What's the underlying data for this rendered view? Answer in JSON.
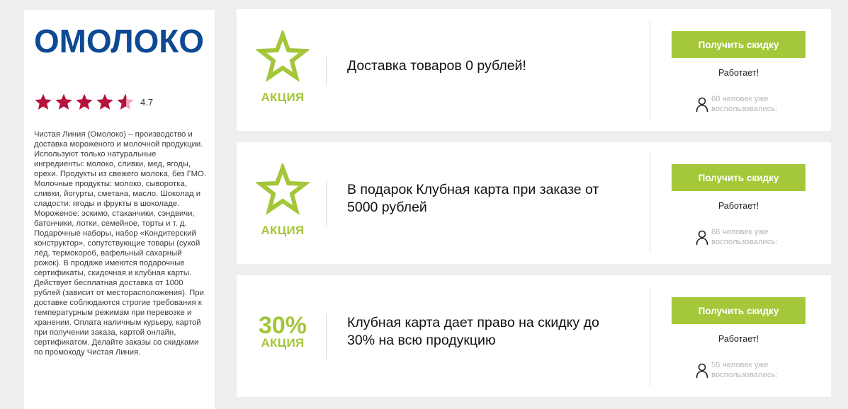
{
  "sidebar": {
    "logo_text": "ОМОЛОКО",
    "rating_value": "4.7",
    "rating_stars": 4.7,
    "description": "Чистая Линия (Омолоко) – производство и доставка мороженого и молочной продукции. Используют только натуральные ингредиенты: молоко, сливки, мед, ягоды, орехи. Продукты из свежего молока, без ГМО. Молочные продукты: молоко, сыворотка, сливки, йогурты, сметана, масло. Шоколад и сладости: ягоды и фрукты в шоколаде. Мороженое: эскимо, стаканчики, сэндвичи, батончики, лотки, семейное, торты и т. д. Подарочные наборы, набор «Кондитерский конструктор», сопутствующие товары (сухой лёд, термокороб, вафельный сахарный рожок). В продаже имеются подарочные сертификаты, скидочная и клубная карты. Действует бесплатная доставка от 1000 рублей (зависит от месторасположения). При доставке соблюдаются строгие требования к температурным режимам при перевозке и хранении. Оплата наличным курьеру, картой при получении заказа, картой онлайн, сертификатом. Делайте заказы со скидками по промокоду Чистая Линия."
  },
  "colors": {
    "accent": "#a4c639",
    "button": "#a4c83a",
    "logo": "#0d4a93",
    "rating_star": "#b5123c",
    "rating_star_empty": "#f2a7bd"
  },
  "coupons": [
    {
      "badge_label": "АКЦИЯ",
      "badge_icon": "star-outline-icon",
      "title": "Доставка товаров 0 рублей!",
      "button_label": "Получить скидку",
      "status": "Работает!",
      "users_text": "60 человек уже воспользовались:"
    },
    {
      "badge_label": "АКЦИЯ",
      "badge_icon": "star-outline-icon",
      "title": "В подарок Клубная карта при заказе от 5000 рублей",
      "button_label": "Получить скидку",
      "status": "Работает!",
      "users_text": "86 человек уже воспользовались:"
    },
    {
      "badge_label": "АКЦИЯ",
      "badge_percent": "30%",
      "title": "Клубная карта дает право на скидку до 30% на всю продукцию",
      "button_label": "Получить скидку",
      "status": "Работает!",
      "users_text": "55 человек уже воспользовались:"
    }
  ]
}
